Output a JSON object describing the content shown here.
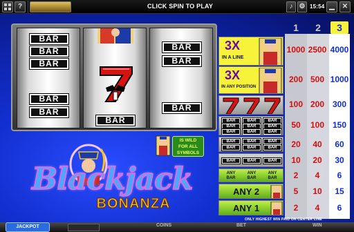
{
  "topbar": {
    "menu_icon": "menu-grid-icon",
    "help_label": "?",
    "coins_label": "",
    "hint_text": "CLICK SPIN TO PLAY",
    "clock_text": "15:54"
  },
  "reels": [
    {
      "name": "reel-1",
      "symbols": [
        "BAR",
        "BAR",
        "BAR",
        "BAR",
        "BAR"
      ]
    },
    {
      "name": "reel-2",
      "symbols": [
        "jack",
        "seven",
        "BAR"
      ]
    },
    {
      "name": "reel-3",
      "symbols": [
        "BAR",
        "BAR",
        "BAR"
      ]
    }
  ],
  "paytable": {
    "headers": [
      "1",
      "2",
      "3"
    ],
    "rows": [
      {
        "label_big": "3X",
        "label_small": "IN A LINE",
        "pays": [
          "1000",
          "2500",
          "4000"
        ]
      },
      {
        "label_big": "3X",
        "label_small": "IN ANY POSITION",
        "pays": [
          "200",
          "500",
          "1000"
        ]
      },
      {
        "label_big": "",
        "label_small": "",
        "pays": [
          "100",
          "200",
          "300"
        ]
      },
      {
        "label_big": "",
        "label_small": "",
        "pays": [
          "50",
          "100",
          "150"
        ]
      },
      {
        "label_big": "",
        "label_small": "",
        "pays": [
          "20",
          "40",
          "60"
        ]
      },
      {
        "label_big": "",
        "label_small": "",
        "pays": [
          "10",
          "20",
          "30"
        ]
      },
      {
        "label_big": "ANY BAR",
        "label_small": "",
        "pays": [
          "2",
          "4",
          "6"
        ]
      },
      {
        "label_big": "ANY 2",
        "label_small": "",
        "pays": [
          "5",
          "10",
          "15"
        ]
      },
      {
        "label_big": "ANY 1",
        "label_small": "",
        "pays": [
          "2",
          "4",
          "6"
        ]
      }
    ],
    "note": "ONLY HIGHEST WIN PAID ON CENTER LINE"
  },
  "wild_badge": {
    "text_line1": "IS WILD",
    "text_line2": "FOR ALL",
    "text_line3": "SYMBOLS"
  },
  "logo": {
    "line1": "Blackjack",
    "line2": "BONANZA"
  },
  "bottombar": {
    "brand": "JACKPOT",
    "button_label": "",
    "coins_label": "COINS",
    "bet_label": "BET",
    "win_label": "WIN"
  },
  "colors": {
    "bg": "#1230d0",
    "gold": "#f7c21a",
    "red": "#d60e0e",
    "blue": "#102cd6"
  }
}
